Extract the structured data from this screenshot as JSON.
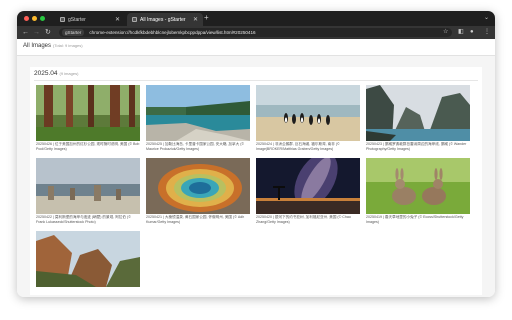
{
  "tabs": [
    {
      "title": "gStarter"
    },
    {
      "title": "All Images - gStarter"
    }
  ],
  "address_bar": {
    "chip_label": "gStarter",
    "url": "chrome-extension://hcdkfkbdebhblcnejlobemkpbcppdppa/view/list.html#20250416"
  },
  "page": {
    "title": "All Images",
    "count": "(Total: 9 images)"
  },
  "section": {
    "label": "2025.04",
    "count": "(9 images)"
  },
  "images": [
    {
      "caption": "20250426 | 位于美国加州的红杉公园, 现时随时说明, 美国 (© Bob Pool/Getty Images)",
      "scene": "redwood-forest"
    },
    {
      "caption": "20250425 | 加勒比海岛, 卡里普卡国家公园, 安大略, 加拿大 (© Maurice Prokaziuk/Getty Images)",
      "scene": "rocky-coast-lake"
    },
    {
      "caption": "20250424 | 非洲企鹅群, 巨石海滩, 福尔斯湾, 南非 (© Image|BROKER/Matthias Graben/Getty Images)",
      "scene": "penguin-beach"
    },
    {
      "caption": "20250423 | 挪威罗弗敦群岛雷讷周边的海岸线, 挪威 (© Wander Photography/Getty Images)",
      "scene": "fjord-mountains"
    },
    {
      "caption": "20250422 | 莫利斯堡的海岸与遗迹 (峭壁) 的景观, 阿拉伯 (© Frank Lukasseck/Shutterstock Photo)",
      "scene": "stone-pillars-coast"
    },
    {
      "caption": "20250421 | 大棱镜温泉, 黄石国家公园, 怀俄明州, 美国 (© Adh Kumar/Getty Images)",
      "scene": "grand-prismatic-spring"
    },
    {
      "caption": "20250420 | 银河下的约书亚树, 加利福尼亚州, 美国 (© Chao Zhang/Getty Images)",
      "scene": "milky-way-night"
    },
    {
      "caption": "20250419 | 春天草地里的小兔子 (© Ecoss/Shutterstock/Getty Images)",
      "scene": "rabbits-meadow"
    },
    {
      "caption": "",
      "scene": "canyon-cliffs"
    }
  ],
  "toolbar_icons": [
    "back-icon",
    "forward-icon",
    "reload-icon",
    "star-icon",
    "extension-icon",
    "profile-icon",
    "menu-icon"
  ]
}
